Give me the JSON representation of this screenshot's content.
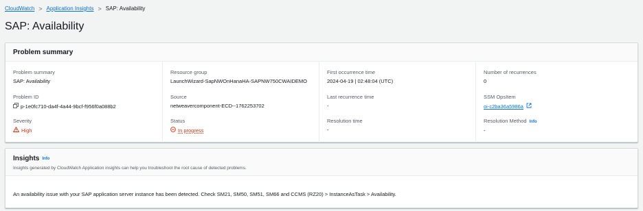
{
  "breadcrumb": {
    "items": [
      "CloudWatch",
      "Application Insights"
    ],
    "current": "SAP: Availability",
    "separator": ">"
  },
  "page": {
    "title": "SAP: Availability"
  },
  "summary": {
    "title": "Problem summary",
    "fields": {
      "problem_summary": {
        "label": "Problem summary",
        "value": "SAP: Availability"
      },
      "resource_group": {
        "label": "Resource group",
        "value": "LaunchWizard-SapNWOnHanaHA-SAPNW750CWAIDEMO"
      },
      "first_occurrence": {
        "label": "First occurrence time",
        "value": "2024-04-19 | 02:48:04 (UTC)"
      },
      "recurrences": {
        "label": "Number of recurrences",
        "value": "0"
      },
      "problem_id": {
        "label": "Problem ID",
        "value": "p-1e0fc710-da4f-4a44-9bcf-f956f0a088b2"
      },
      "source": {
        "label": "Source",
        "value": "netweavercomponent-ECD--1762253702"
      },
      "last_recurrence": {
        "label": "Last recurrence time",
        "value": "-"
      },
      "opsitem": {
        "label": "SSM OpsItem",
        "value": "oi-c2ba36a5986a"
      },
      "severity": {
        "label": "Severity",
        "value": "High"
      },
      "status": {
        "label": "Status",
        "value": "In progress"
      },
      "resolution_time": {
        "label": "Resolution time",
        "value": "-"
      },
      "resolution_method": {
        "label": "Resolution Method",
        "info": "Info",
        "value": "-"
      }
    }
  },
  "insights": {
    "title": "Insights",
    "info": "Info",
    "description": "Insights generated by CloudWatch Application insights can help you troubleshoot the root cause of detected problems.",
    "body": "An availability issue with your SAP application server instance has been detected. Check SM21, SM50, SM51, SM66 and CCMS (RZ20) > InstanceAsTask > Availability."
  },
  "colors": {
    "link": "#0972d3",
    "severity_high": "#d13212",
    "background": "#f2f3f3",
    "panel": "#ffffff"
  },
  "icons": {
    "copy": "copy-icon",
    "external": "external-link-icon",
    "warning": "warning-icon",
    "status": "in-progress-icon"
  }
}
